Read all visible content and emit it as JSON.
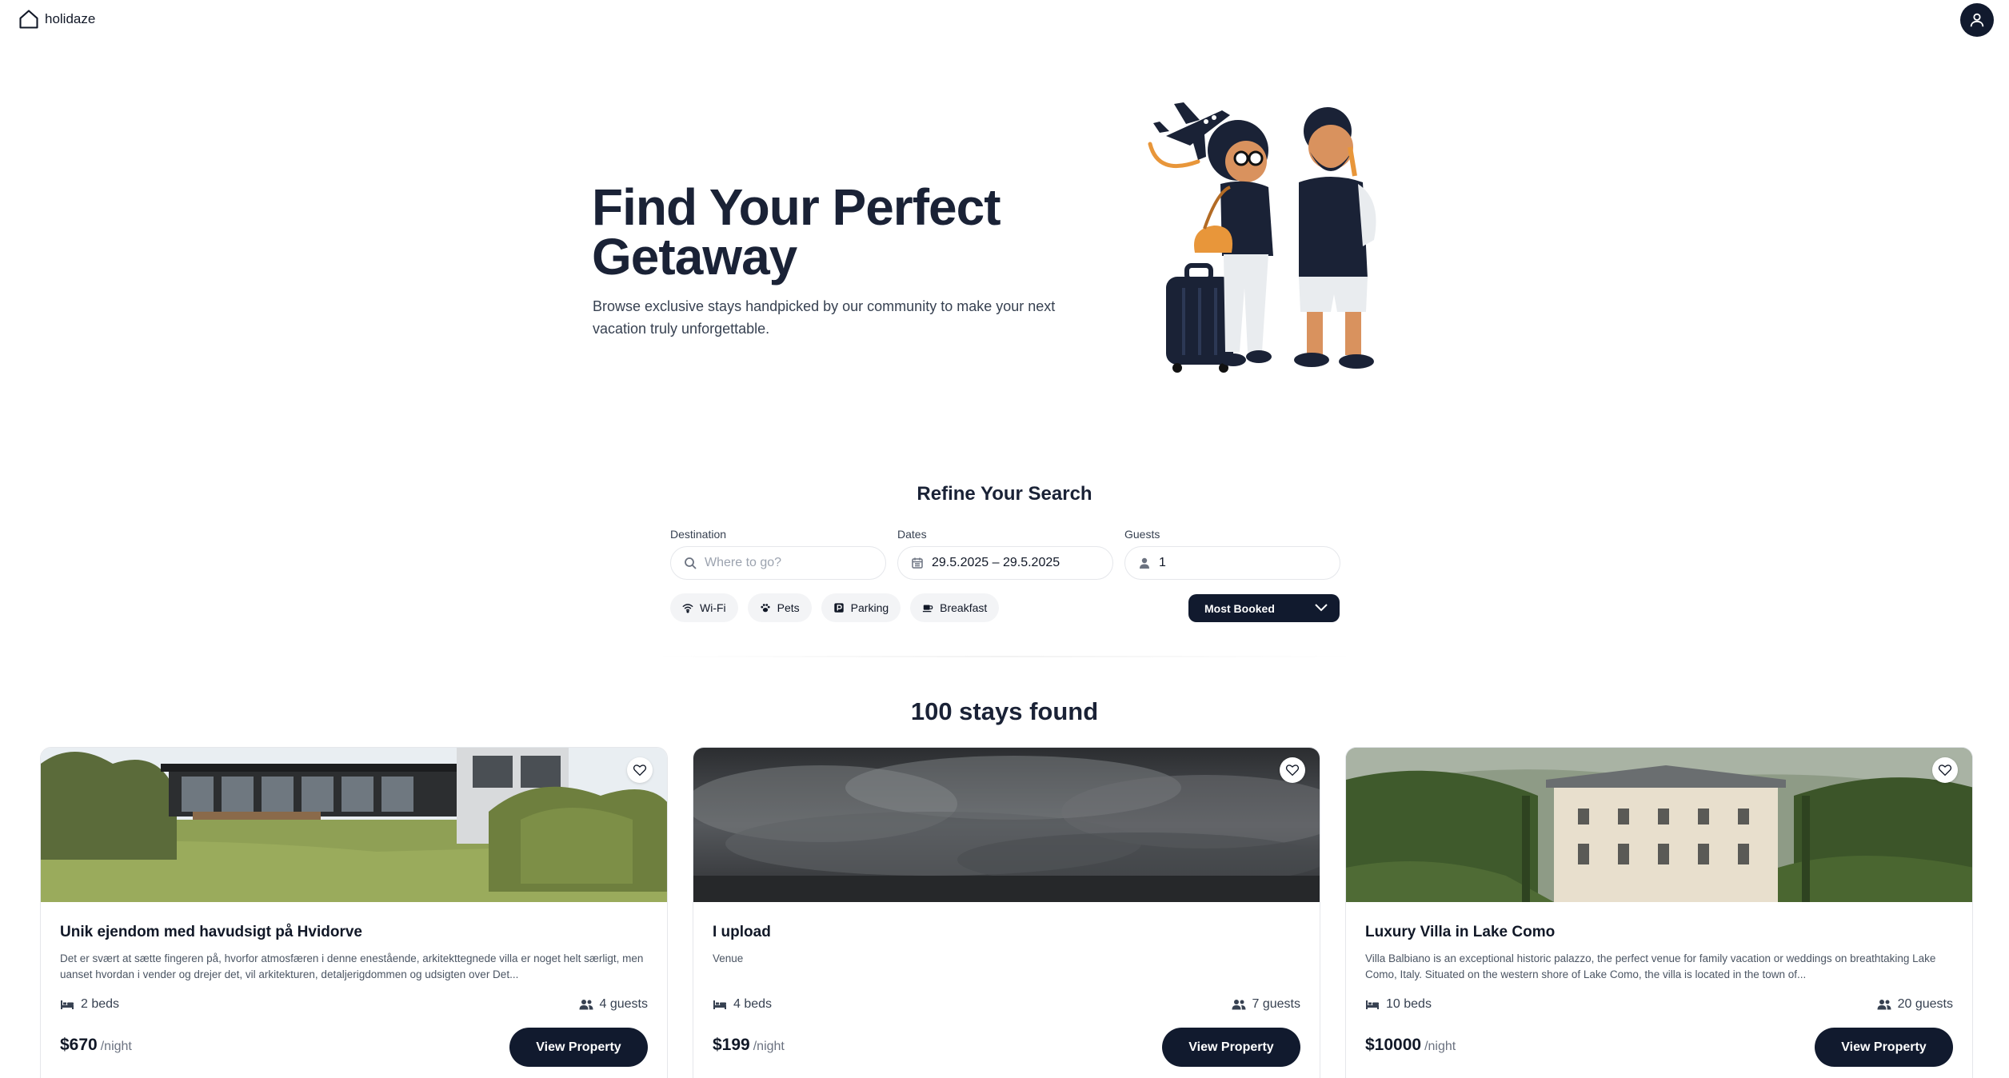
{
  "header": {
    "logo_text": "holidaze",
    "logo_icon": "house-icon",
    "profile_icon": "user-icon"
  },
  "hero": {
    "title": "Find Your Perfect Getaway",
    "subtitle": "Browse exclusive stays handpicked by our community to make your next vacation truly unforgettable."
  },
  "search": {
    "title": "Refine Your Search",
    "destination": {
      "label": "Destination",
      "placeholder": "Where to go?",
      "value": ""
    },
    "dates": {
      "label": "Dates",
      "value": "29.5.2025 – 29.5.2025"
    },
    "guests": {
      "label": "Guests",
      "value": "1"
    },
    "filters": [
      {
        "label": "Wi-Fi",
        "icon": "wifi-icon"
      },
      {
        "label": "Pets",
        "icon": "paw-icon"
      },
      {
        "label": "Parking",
        "icon": "parking-icon"
      },
      {
        "label": "Breakfast",
        "icon": "coffee-icon"
      }
    ],
    "sort": {
      "selected": "Most Booked"
    }
  },
  "results": {
    "count_text": "100 stays found",
    "cards": [
      {
        "title": "Unik ejendom med havudsigt på Hvidorve",
        "description": "Det er svært at sætte fingeren på, hvorfor atmosfæren i denne enestående, arkitekttegnede villa er noget helt særligt, men uanset hvordan i vender og drejer det, vil arkitekturen, detaljerigdommen og udsigten over Det...",
        "beds": "2 beds",
        "guests": "4 guests",
        "price": "$670",
        "price_unit": "/night",
        "button": "View Property"
      },
      {
        "title": "I upload",
        "description": "Venue",
        "beds": "4 beds",
        "guests": "7 guests",
        "price": "$199",
        "price_unit": "/night",
        "button": "View Property"
      },
      {
        "title": "Luxury Villa in Lake Como",
        "description": "Villa Balbiano is an exceptional historic palazzo, the perfect venue for family vacation or weddings on breathtaking Lake Como, Italy. Situated on the western shore of Lake Como, the villa is located in the town of...",
        "beds": "10 beds",
        "guests": "20 guests",
        "price": "$10000",
        "price_unit": "/night",
        "button": "View Property"
      }
    ]
  },
  "colors": {
    "primary_dark": "#111a2e",
    "heading": "#1a2236",
    "chip_bg": "#f3f4f6",
    "accent_orange": "#e8963a"
  }
}
